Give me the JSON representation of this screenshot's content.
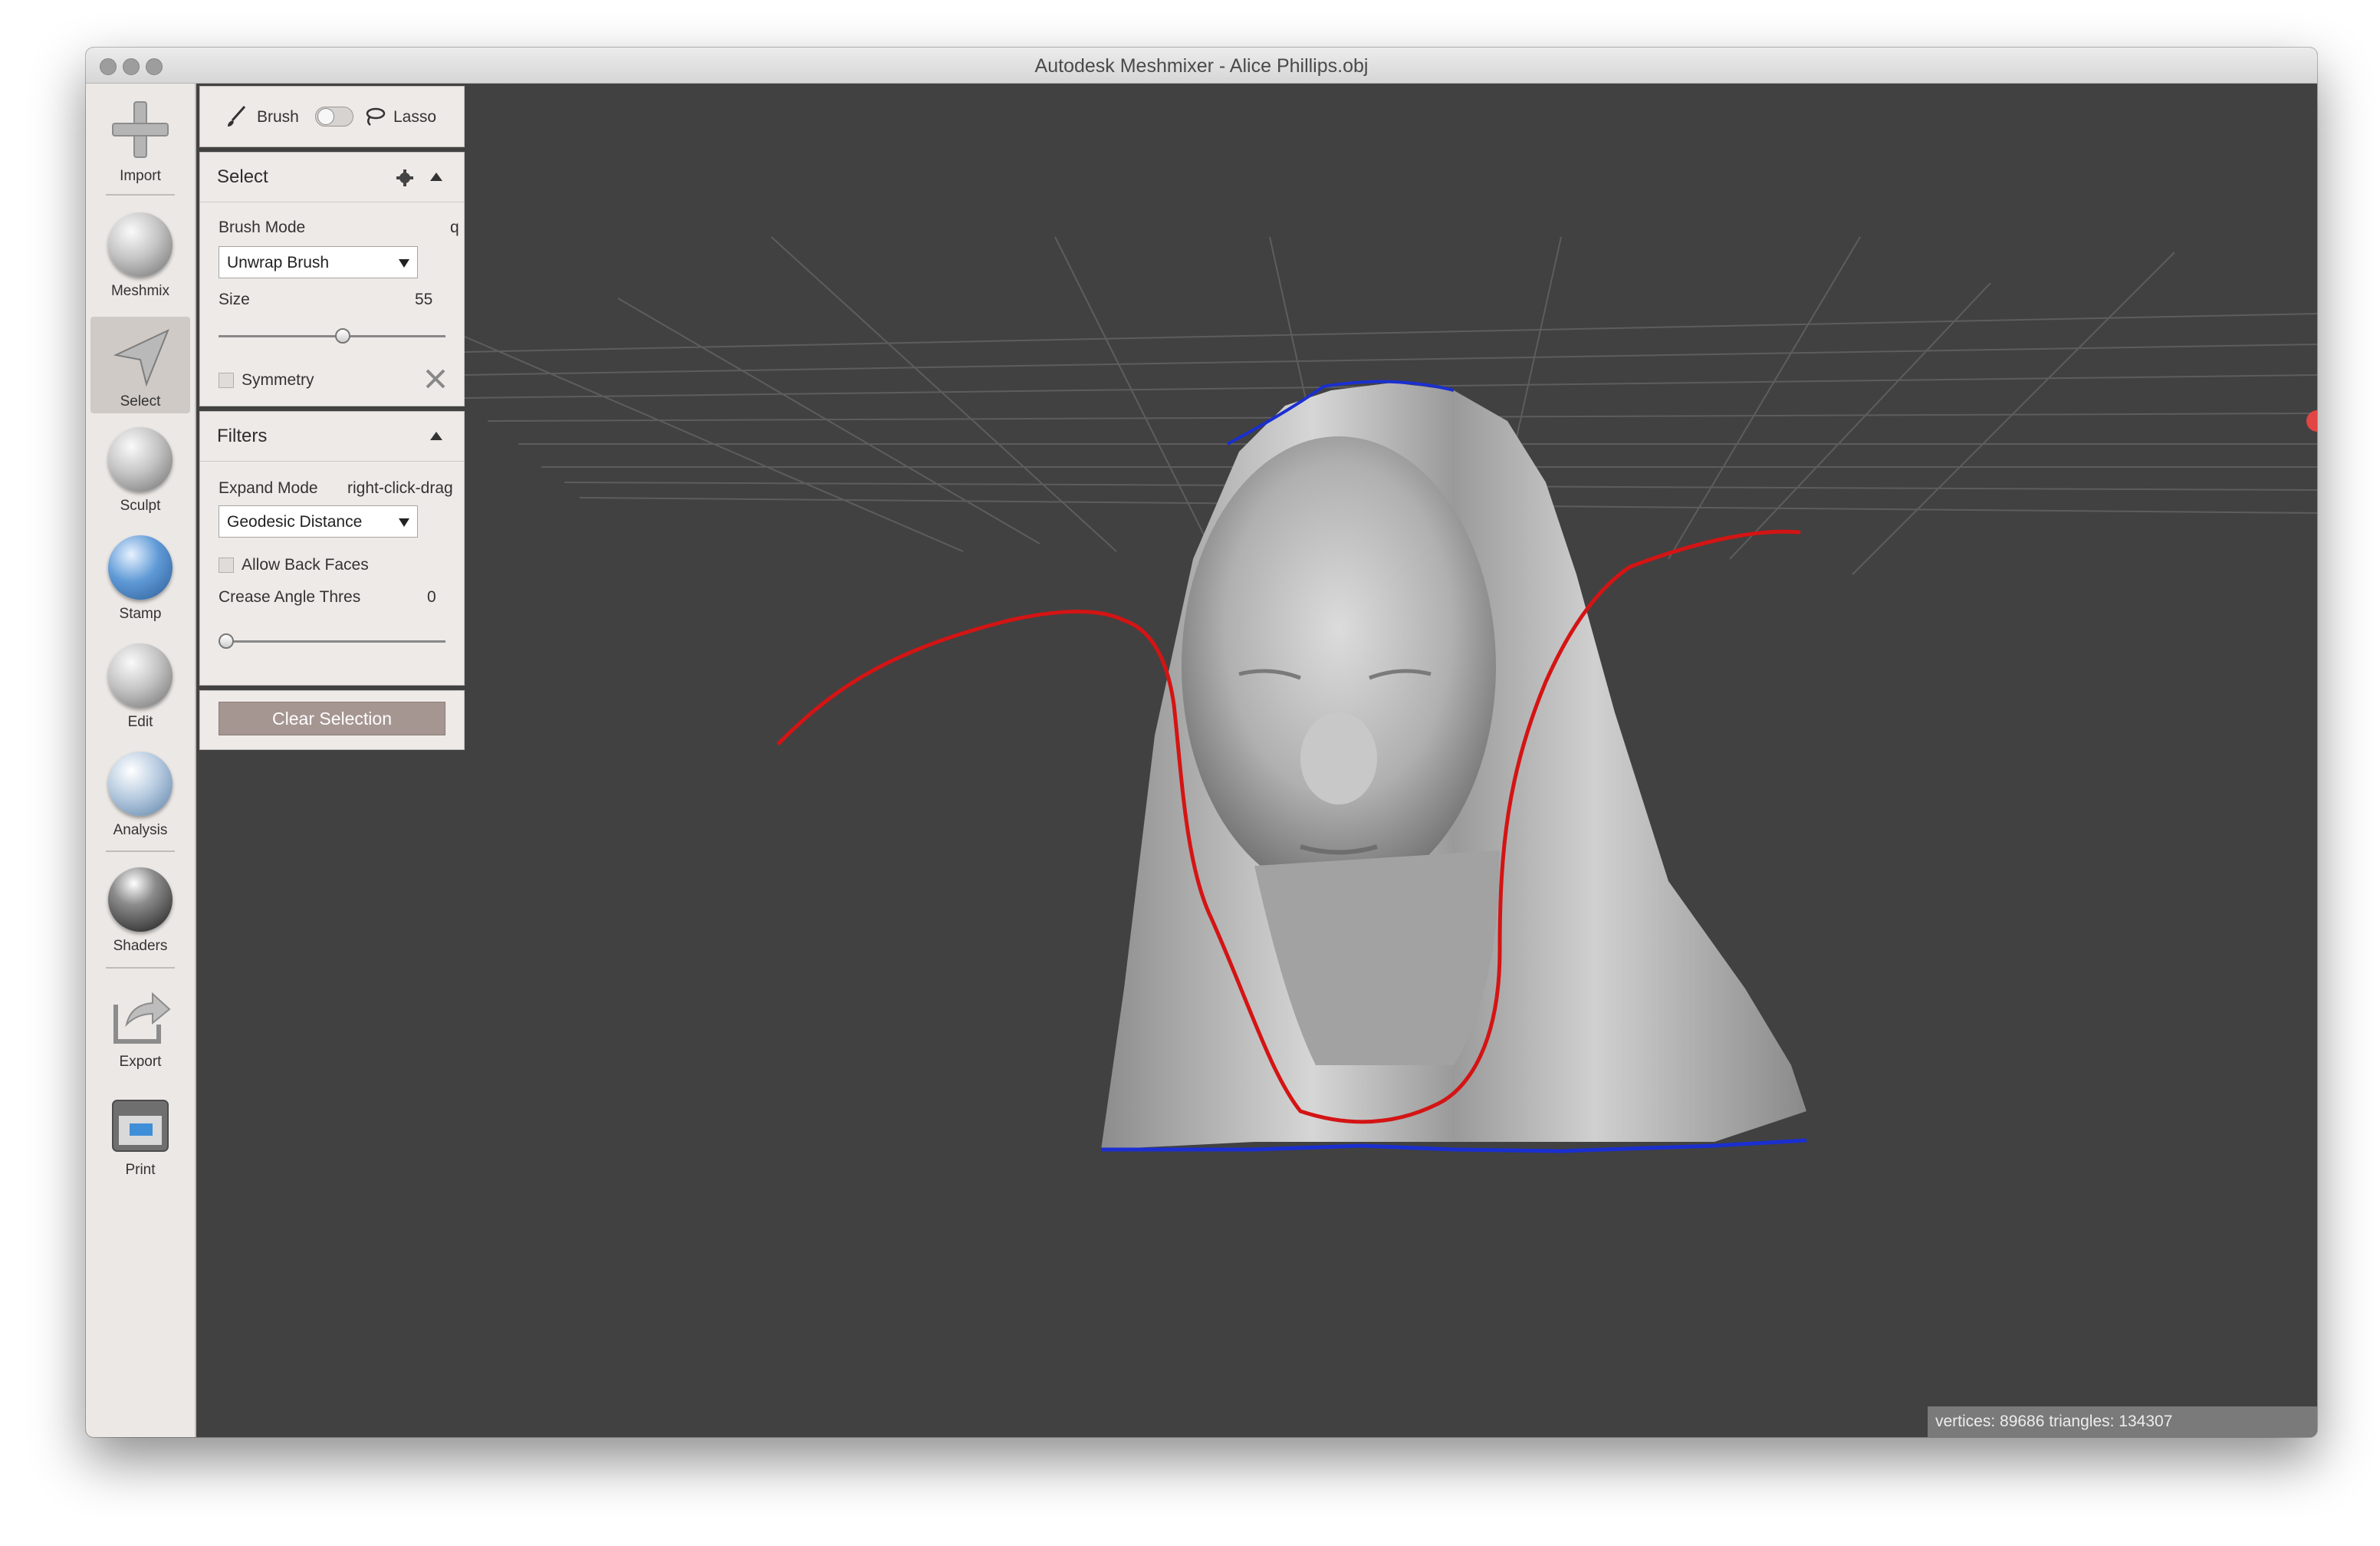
{
  "window": {
    "title": "Autodesk Meshmixer - Alice Phillips.obj"
  },
  "toolbar": {
    "items": [
      {
        "label": "Import",
        "icon": "plus-icon"
      },
      {
        "label": "Meshmix",
        "icon": "meshmix-sphere-icon"
      },
      {
        "label": "Select",
        "icon": "select-arrow-icon",
        "active": true
      },
      {
        "label": "Sculpt",
        "icon": "sculpt-brush-icon"
      },
      {
        "label": "Stamp",
        "icon": "stamp-icon"
      },
      {
        "label": "Edit",
        "icon": "edit-icon"
      },
      {
        "label": "Analysis",
        "icon": "analysis-icon"
      },
      {
        "label": "Shaders",
        "icon": "shaders-icon"
      },
      {
        "label": "Export",
        "icon": "export-icon"
      },
      {
        "label": "Print",
        "icon": "print-icon"
      }
    ]
  },
  "mode_toggle": {
    "brush_label": "Brush",
    "lasso_label": "Lasso"
  },
  "select_panel": {
    "title": "Select",
    "brush_mode_label": "Brush Mode",
    "brush_mode_hotkey": "q",
    "brush_mode_value": "Unwrap Brush",
    "size_label": "Size",
    "size_value": "55",
    "size_fraction": 0.55,
    "symmetry_label": "Symmetry",
    "symmetry_checked": false
  },
  "filters_panel": {
    "title": "Filters",
    "expand_mode_label": "Expand Mode",
    "expand_mode_hint": "right-click-drag",
    "expand_mode_value": "Geodesic Distance",
    "allow_back_faces_label": "Allow Back Faces",
    "allow_back_faces_checked": false,
    "crease_label": "Crease Angle Thres",
    "crease_value": "0",
    "crease_fraction": 0
  },
  "actions": {
    "clear_selection_label": "Clear Selection"
  },
  "status_bar": {
    "text": "vertices: 89686 triangles: 134307"
  },
  "colors": {
    "viewport_bg": "#414141",
    "selection_curve": "#d41414",
    "boundary_edge": "#1a2fd0",
    "button_bg": "#a69691",
    "panel_bg": "#eeeae7"
  }
}
